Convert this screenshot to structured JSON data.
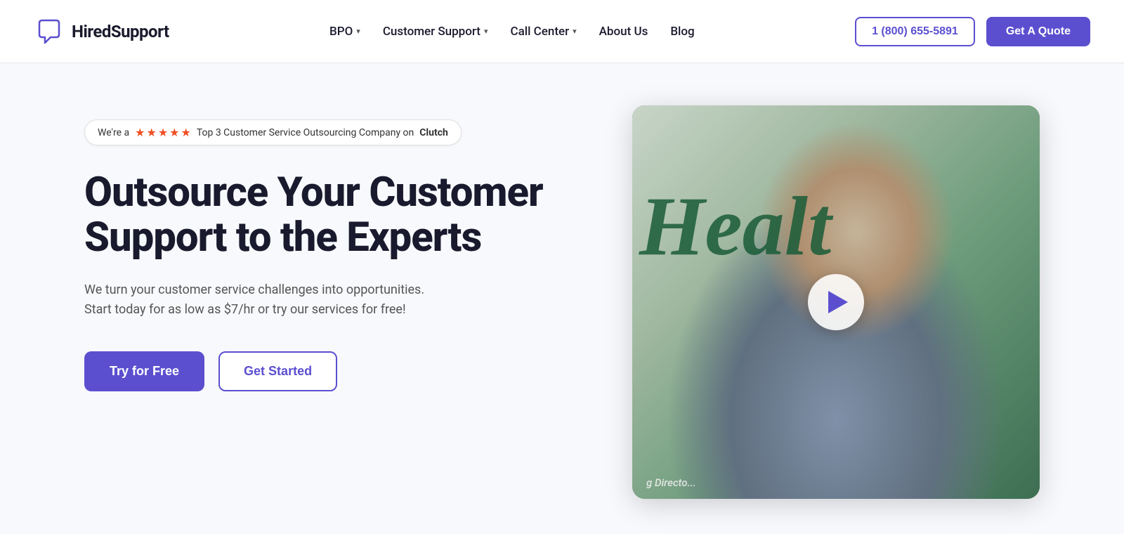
{
  "navbar": {
    "logo_text": "HiredSupport",
    "nav_items": [
      {
        "label": "BPO",
        "has_dropdown": true
      },
      {
        "label": "Customer Support",
        "has_dropdown": true
      },
      {
        "label": "Call Center",
        "has_dropdown": true
      },
      {
        "label": "About Us",
        "has_dropdown": false
      },
      {
        "label": "Blog",
        "has_dropdown": false
      }
    ],
    "phone": "1 (800) 655-5891",
    "quote_label": "Get A Quote"
  },
  "hero": {
    "badge_prefix": "We're a",
    "badge_suffix": "Top 3 Customer Service Outsourcing Company on",
    "badge_bold": "Clutch",
    "title": "Outsource Your Customer Support to the Experts",
    "subtitle": "We turn your customer service challenges into opportunities. Start today for as low as $7/hr or try our services for free!",
    "btn_primary": "Try for Free",
    "btn_secondary": "Get Started",
    "video_text": "Healt",
    "video_caption": "g Directo..."
  }
}
